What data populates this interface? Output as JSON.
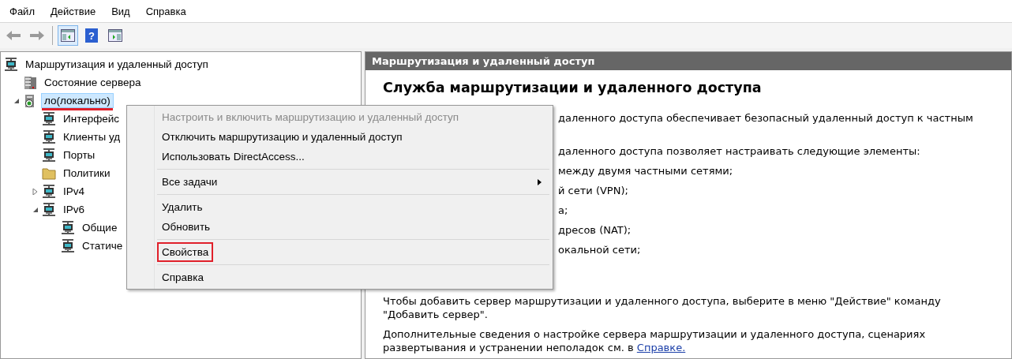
{
  "menu_bar": [
    "Файл",
    "Действие",
    "Вид",
    "Справка"
  ],
  "toolbar": [
    {
      "kind": "back",
      "disabled": true
    },
    {
      "kind": "forward",
      "disabled": true
    },
    {
      "kind": "separator"
    },
    {
      "kind": "tree-toggle",
      "pressed": true
    },
    {
      "kind": "help",
      "pressed": false,
      "label": "?"
    },
    {
      "kind": "action-pane",
      "pressed": false
    }
  ],
  "tree": [
    {
      "label": "Маршрутизация и удаленный доступ",
      "kind": "network",
      "selected": false,
      "underlined": false,
      "children": [
        {
          "label": "Состояние сервера",
          "kind": "status",
          "selected": false,
          "underlined": false
        },
        {
          "label": "ло(локально)",
          "kind": "server",
          "selected": true,
          "underlined": true,
          "expanded": true,
          "children": [
            {
              "label": "Интерфейс",
              "kind": "network",
              "selected": false,
              "underlined": false
            },
            {
              "label": "Клиенты уд",
              "kind": "network",
              "selected": false,
              "underlined": false
            },
            {
              "label": "Порты",
              "kind": "network",
              "selected": false,
              "underlined": false
            },
            {
              "label": "Политики",
              "kind": "folder",
              "selected": false,
              "underlined": false
            },
            {
              "label": "IPv4",
              "kind": "network",
              "selected": false,
              "underlined": false,
              "expanded": false
            },
            {
              "label": "IPv6",
              "kind": "network",
              "selected": false,
              "underlined": false,
              "expanded": true,
              "children": [
                {
                  "label": "Общие",
                  "kind": "network",
                  "selected": false,
                  "underlined": false
                },
                {
                  "label": "Статиче",
                  "kind": "network",
                  "selected": false,
                  "underlined": false
                }
              ]
            }
          ]
        }
      ]
    }
  ],
  "context_menu": [
    [
      {
        "label": "Настроить и включить маршрутизацию и удаленный доступ",
        "disabled": true,
        "submenu": false,
        "highlighted": false
      },
      {
        "label": "Отключить маршрутизацию и удаленный доступ",
        "disabled": false,
        "submenu": false,
        "highlighted": false
      },
      {
        "label": "Использовать DirectAccess...",
        "disabled": false,
        "submenu": false,
        "highlighted": false
      }
    ],
    [
      {
        "label": "Все задачи",
        "disabled": false,
        "submenu": true,
        "highlighted": false
      }
    ],
    [
      {
        "label": "Удалить",
        "disabled": false,
        "submenu": false,
        "highlighted": false
      },
      {
        "label": "Обновить",
        "disabled": false,
        "submenu": false,
        "highlighted": false
      }
    ],
    [
      {
        "label": "Свойства",
        "disabled": false,
        "submenu": false,
        "highlighted": true
      }
    ],
    [
      {
        "label": "Справка",
        "disabled": false,
        "submenu": false,
        "highlighted": false
      }
    ]
  ],
  "details": {
    "header": "Маршрутизация и удаленный доступ",
    "title": "Служба маршрутизации и удаленного доступа",
    "fragments": [
      "даленного доступа обеспечивает безопасный удаленный доступ к частным",
      "даленного доступа позволяет настраивать следующие элементы:",
      "между двумя частными сетями;",
      "й сети (VPN);",
      "а;",
      "дресов (NAT);",
      "окальной сети;"
    ],
    "paragraphs": [
      {
        "text": "Чтобы добавить сервер маршрутизации и удаленного доступа, выберите в меню \"Действие\" команду \"Добавить сервер\"."
      },
      {
        "text": "Дополнительные сведения о настройке сервера маршрутизации и удаленного доступа, сценариях развертывания и устранении неполадок см. в ",
        "link": "Справке."
      }
    ]
  }
}
